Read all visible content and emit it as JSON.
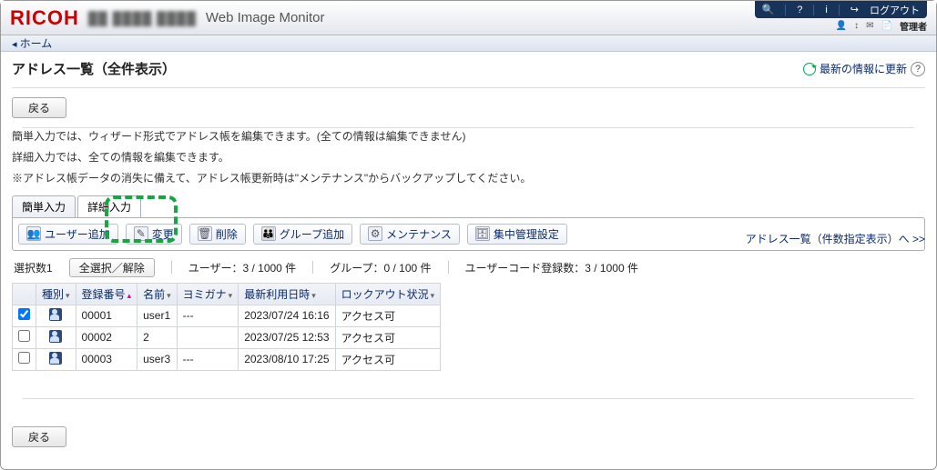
{
  "header": {
    "brand": "RICOH",
    "model": "██ ████ ████",
    "app_name": "Web Image Monitor",
    "logout": "ログアウト",
    "role": "管理者"
  },
  "breadcrumb": {
    "home": "ホーム"
  },
  "page_title": "アドレス一覧（全件表示）",
  "refresh_label": "最新の情報に更新",
  "back_label": "戻る",
  "descriptions": {
    "line1": "簡単入力では、ウィザード形式でアドレス帳を編集できます。(全ての情報は編集できません)",
    "line2": "詳細入力では、全ての情報を編集できます。",
    "line3": "※アドレス帳データの消失に備えて、アドレス帳更新時は\"メンテナンス\"からバックアップしてください。"
  },
  "tabs": {
    "simple": "簡単入力",
    "detail": "詳細入力"
  },
  "toolbar": {
    "add_user": "ユーザー追加",
    "edit": "変更",
    "delete": "削除",
    "add_group": "グループ追加",
    "maintenance": "メンテナンス",
    "central": "集中管理設定"
  },
  "top_link": "アドレス一覧（件数指定表示）へ >>",
  "status": {
    "selection_label": "選択数",
    "selection_count": "1",
    "select_all": "全選択／解除",
    "users": "ユーザー：3 / 1000 件",
    "groups": "グループ：0 / 100 件",
    "codes": "ユーザーコード登録数：3 / 1000 件"
  },
  "columns": {
    "type": "種別",
    "reg_no": "登録番号",
    "name": "名前",
    "kana": "ヨミガナ",
    "last_used": "最新利用日時",
    "lockout": "ロックアウト状況"
  },
  "rows": [
    {
      "checked": true,
      "reg_no": "00001",
      "name": "user1",
      "kana": "---",
      "last_used": "2023/07/24 16:16",
      "lockout": "アクセス可"
    },
    {
      "checked": false,
      "reg_no": "00002",
      "name": "2",
      "kana": "",
      "last_used": "2023/07/25 12:53",
      "lockout": "アクセス可"
    },
    {
      "checked": false,
      "reg_no": "00003",
      "name": "user3",
      "kana": "---",
      "last_used": "2023/08/10 17:25",
      "lockout": "アクセス可"
    }
  ]
}
